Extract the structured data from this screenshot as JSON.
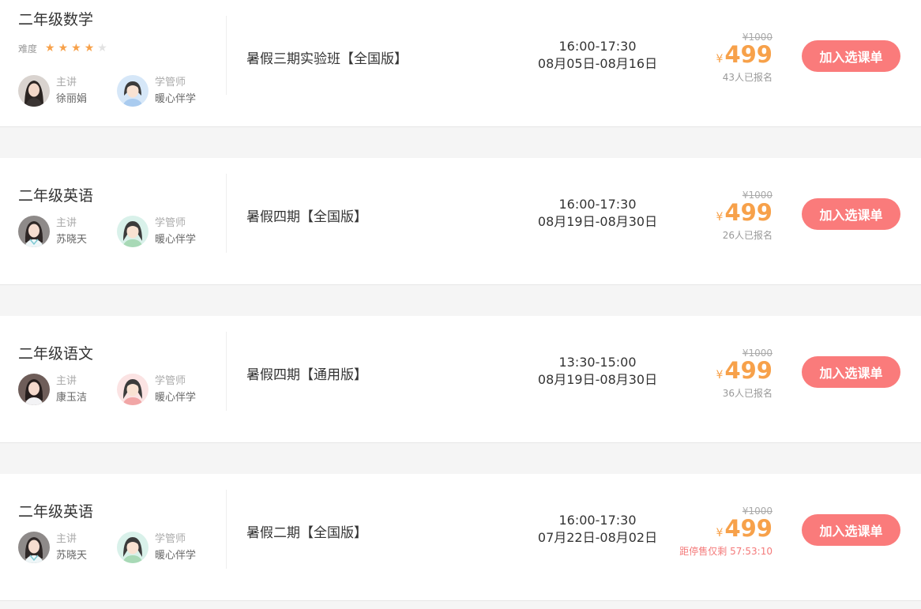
{
  "colors": {
    "accent": "#f7a14a",
    "button": "#fa7b7b",
    "countdown": "#f47a7a",
    "text": "#333333",
    "muted": "#999999"
  },
  "courses": [
    {
      "subject": "二年级数学",
      "difficulty_label": "难度",
      "difficulty_rating": 4,
      "difficulty_max": 5,
      "teacher_role": "主讲",
      "teacher_name": "徐丽娟",
      "assistant_role": "学管师",
      "assistant_name": "暖心伴学",
      "class_name": "暑假三期实验班【全国版】",
      "time": "16:00-17:30",
      "dates": "08月05日-08月16日",
      "orig_price": "¥1000",
      "currency": "¥",
      "price": "499",
      "enrolled": "43人已报名",
      "button_label": "加入选课单"
    },
    {
      "subject": "二年级英语",
      "teacher_role": "主讲",
      "teacher_name": "苏晓天",
      "assistant_role": "学管师",
      "assistant_name": "暖心伴学",
      "class_name": "暑假四期【全国版】",
      "time": "16:00-17:30",
      "dates": "08月19日-08月30日",
      "orig_price": "¥1000",
      "currency": "¥",
      "price": "499",
      "enrolled": "26人已报名",
      "button_label": "加入选课单"
    },
    {
      "subject": "二年级语文",
      "teacher_role": "主讲",
      "teacher_name": "康玉洁",
      "assistant_role": "学管师",
      "assistant_name": "暖心伴学",
      "class_name": "暑假四期【通用版】",
      "time": "13:30-15:00",
      "dates": "08月19日-08月30日",
      "orig_price": "¥1000",
      "currency": "¥",
      "price": "499",
      "enrolled": "36人已报名",
      "button_label": "加入选课单"
    },
    {
      "subject": "二年级英语",
      "teacher_role": "主讲",
      "teacher_name": "苏晓天",
      "assistant_role": "学管师",
      "assistant_name": "暖心伴学",
      "class_name": "暑假二期【全国版】",
      "time": "16:00-17:30",
      "dates": "07月22日-08月02日",
      "orig_price": "¥1000",
      "currency": "¥",
      "price": "499",
      "countdown": "距停售仅剩 57:53:10",
      "button_label": "加入选课单"
    }
  ]
}
